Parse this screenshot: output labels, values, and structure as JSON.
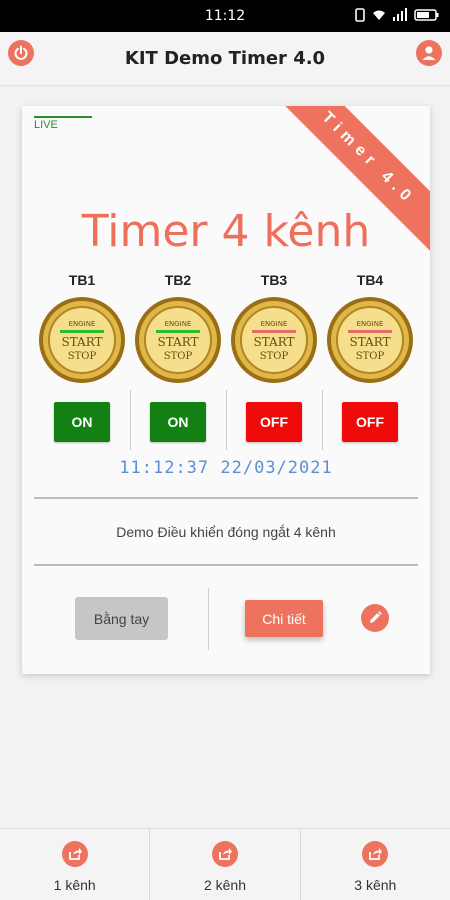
{
  "status_bar": {
    "time": "11:12"
  },
  "app_bar": {
    "title": "KIT Demo Timer 4.0",
    "left_icon": "power-icon",
    "right_icon": "account-icon"
  },
  "card": {
    "live_label": "LIVE",
    "ribbon_text": "Timer 4.0",
    "title": "Timer 4 kênh",
    "devices": [
      {
        "name": "TB1",
        "medal_top": "ENGINE",
        "medal_main": "START",
        "medal_bottom": "STOP",
        "state": "ON"
      },
      {
        "name": "TB2",
        "medal_top": "ENGINE",
        "medal_main": "START",
        "medal_bottom": "STOP",
        "state": "ON"
      },
      {
        "name": "TB3",
        "medal_top": "ENGINE",
        "medal_main": "START",
        "medal_bottom": "STOP",
        "state": "OFF"
      },
      {
        "name": "TB4",
        "medal_top": "ENGINE",
        "medal_main": "START",
        "medal_bottom": "STOP",
        "state": "OFF"
      }
    ],
    "clock": "11:12:37 22/03/2021",
    "description": "Demo Điều khiển đóng ngắt 4 kênh",
    "manual_button": "Bằng tay",
    "detail_button": "Chi tiết",
    "edit_icon": "pencil-icon"
  },
  "colors": {
    "accent": "#ee735f",
    "on": "#128012",
    "off": "#f20a0a",
    "live": "#2e8b2e",
    "clock": "#5a8fd6"
  },
  "bottom_nav": [
    {
      "label": "1 kênh",
      "icon": "share-icon"
    },
    {
      "label": "2 kênh",
      "icon": "share-icon"
    },
    {
      "label": "3 kênh",
      "icon": "share-icon"
    }
  ]
}
